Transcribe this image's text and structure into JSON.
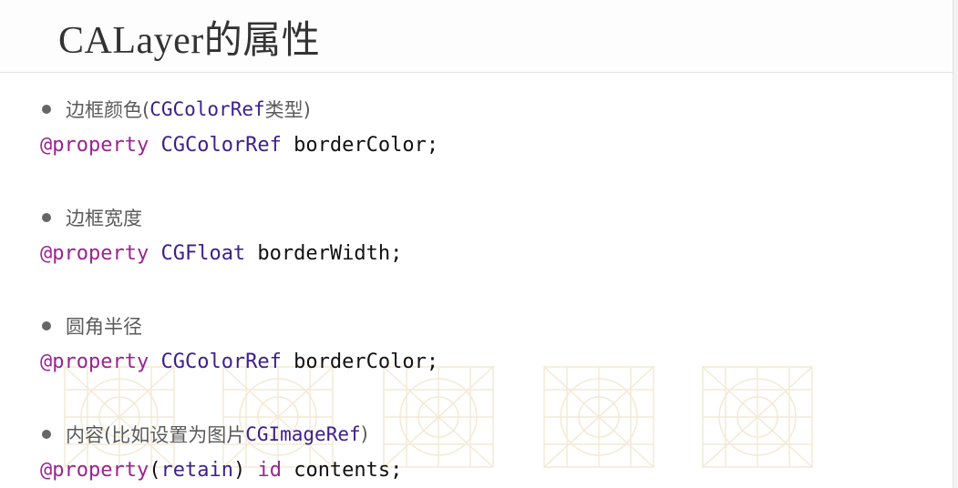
{
  "title": "CALayer的属性",
  "items": [
    {
      "bullet_text": "边框颜色(",
      "bullet_code": "CGColorRef",
      "bullet_suffix": "类型)",
      "code": {
        "keyword": "@property",
        "type": " CGColorRef",
        "rest": " borderColor;"
      }
    },
    {
      "bullet_text": "边框宽度",
      "bullet_code": "",
      "bullet_suffix": "",
      "code": {
        "keyword": "@property",
        "type": " CGFloat",
        "rest": " borderWidth;"
      }
    },
    {
      "bullet_text": "圆角半径",
      "bullet_code": "",
      "bullet_suffix": "",
      "code": {
        "keyword": "@property",
        "type": " CGColorRef",
        "rest": " borderColor;"
      }
    },
    {
      "bullet_text": "内容(比如设置为图片",
      "bullet_code": "CGImageRef",
      "bullet_suffix": ")",
      "code": {
        "keyword": "@property",
        "paren_open": "(",
        "attr": "retain",
        "paren_close": ")",
        "type": " id",
        "rest": " contents;"
      }
    }
  ],
  "colors": {
    "keyword": "#9b2393",
    "type": "#3c1f8c",
    "title": "#333333",
    "watermark": "#f3ead6"
  },
  "decor": [
    "grid-watermark-icon"
  ]
}
